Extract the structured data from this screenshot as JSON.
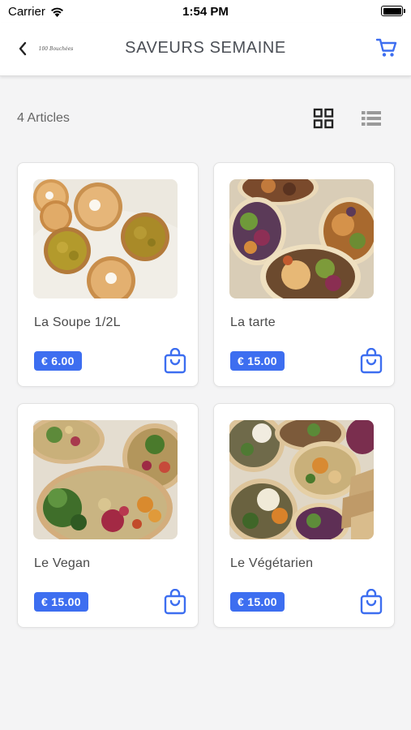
{
  "status_bar": {
    "carrier": "Carrier",
    "time": "1:54 PM"
  },
  "header": {
    "title": "SAVEURS SEMAINE",
    "logo_text": "100 Bouchées"
  },
  "toolbar": {
    "count_label": "4 Articles",
    "active_view": "grid"
  },
  "products": [
    {
      "name": "La Soupe 1/2L",
      "price": "€ 6.00"
    },
    {
      "name": "La tarte",
      "price": "€ 15.00"
    },
    {
      "name": "Le Vegan",
      "price": "€ 15.00"
    },
    {
      "name": "Le Végétarien",
      "price": "€ 15.00"
    }
  ],
  "colors": {
    "accent": "#3d6ef0",
    "background": "#f4f4f5",
    "card": "#ffffff"
  },
  "icons": [
    "wifi-icon",
    "battery-icon",
    "chevron-left-icon",
    "cart-icon",
    "grid-view-icon",
    "list-view-icon",
    "shopping-bag-icon"
  ]
}
